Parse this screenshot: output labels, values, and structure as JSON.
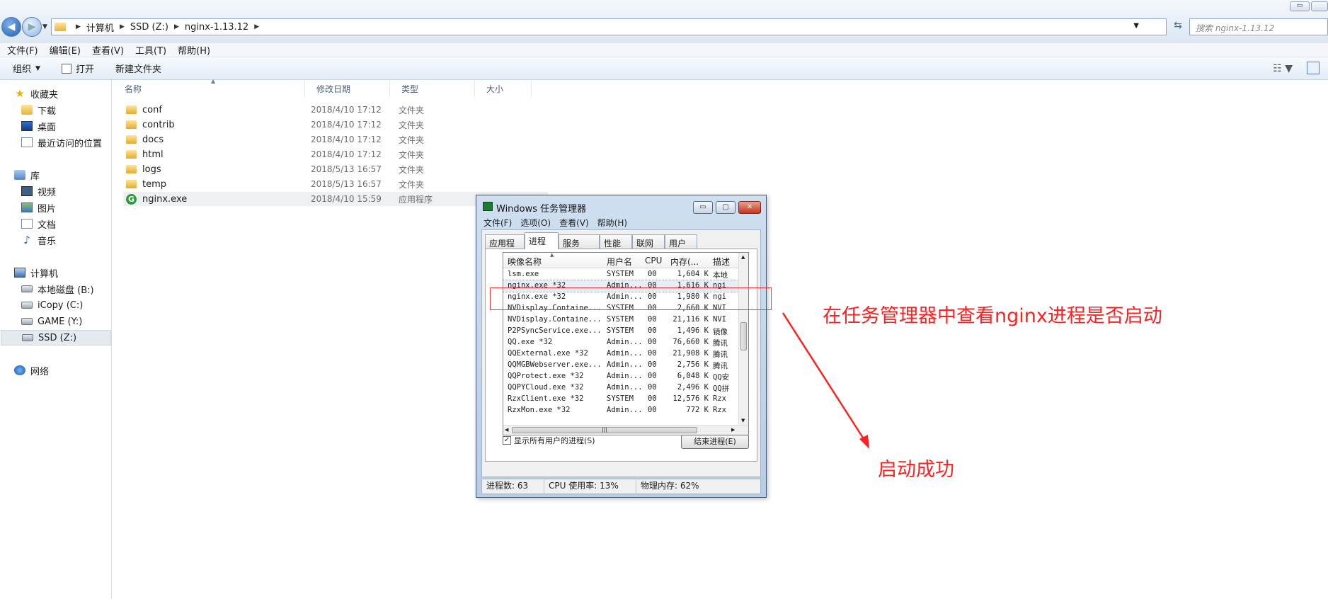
{
  "explorer": {
    "breadcrumb": [
      "计算机",
      "SSD (Z:)",
      "nginx-1.13.12"
    ],
    "search_placeholder": "搜索 nginx-1.13.12",
    "menu": [
      "文件(F)",
      "编辑(E)",
      "查看(V)",
      "工具(T)",
      "帮助(H)"
    ],
    "toolbar": {
      "organize": "组织",
      "open": "打开",
      "new_folder": "新建文件夹"
    },
    "nav": {
      "favorites": "收藏夹",
      "downloads": "下载",
      "desktop": "桌面",
      "recent": "最近访问的位置",
      "libraries": "库",
      "videos": "视频",
      "pictures": "图片",
      "documents": "文档",
      "music": "音乐",
      "computer": "计算机",
      "drive_b": "本地磁盘 (B:)",
      "drive_c": "iCopy (C:)",
      "drive_y": "GAME (Y:)",
      "drive_z": "SSD (Z:)",
      "network": "网络"
    },
    "columns": {
      "name": "名称",
      "date": "修改日期",
      "type": "类型",
      "size": "大小"
    },
    "files": [
      {
        "name": "conf",
        "date": "2018/4/10 17:12",
        "type": "文件夹"
      },
      {
        "name": "contrib",
        "date": "2018/4/10 17:12",
        "type": "文件夹"
      },
      {
        "name": "docs",
        "date": "2018/4/10 17:12",
        "type": "文件夹"
      },
      {
        "name": "html",
        "date": "2018/4/10 17:12",
        "type": "文件夹"
      },
      {
        "name": "logs",
        "date": "2018/5/13 16:57",
        "type": "文件夹"
      },
      {
        "name": "temp",
        "date": "2018/5/13 16:57",
        "type": "文件夹"
      },
      {
        "name": "nginx.exe",
        "date": "2018/4/10 15:59",
        "type": "应用程序"
      }
    ]
  },
  "taskmgr": {
    "title": "Windows 任务管理器",
    "menu": [
      "文件(F)",
      "选项(O)",
      "查看(V)",
      "帮助(H)"
    ],
    "tabs": [
      "应用程序",
      "进程",
      "服务",
      "性能",
      "联网",
      "用户"
    ],
    "columns": {
      "image": "映像名称",
      "user": "用户名",
      "cpu": "CPU",
      "mem": "内存(...",
      "desc": "描述"
    },
    "processes": [
      {
        "image": "lsm.exe",
        "user": "SYSTEM",
        "cpu": "00",
        "mem": "1,604 K",
        "desc": "本地"
      },
      {
        "image": "nginx.exe *32",
        "user": "Admin...",
        "cpu": "00",
        "mem": "1,616 K",
        "desc": "ngi"
      },
      {
        "image": "nginx.exe *32",
        "user": "Admin...",
        "cpu": "00",
        "mem": "1,980 K",
        "desc": "ngi"
      },
      {
        "image": "NVDisplay.Containe...",
        "user": "SYSTEM",
        "cpu": "00",
        "mem": "2,660 K",
        "desc": "NVI"
      },
      {
        "image": "NVDisplay.Containe...",
        "user": "SYSTEM",
        "cpu": "00",
        "mem": "21,116 K",
        "desc": "NVI"
      },
      {
        "image": "P2PSyncService.exe...",
        "user": "SYSTEM",
        "cpu": "00",
        "mem": "1,496 K",
        "desc": "镜像"
      },
      {
        "image": "QQ.exe *32",
        "user": "Admin...",
        "cpu": "00",
        "mem": "76,660 K",
        "desc": "腾讯"
      },
      {
        "image": "QQExternal.exe *32",
        "user": "Admin...",
        "cpu": "00",
        "mem": "21,908 K",
        "desc": "腾讯"
      },
      {
        "image": "QQMGBWebserver.exe...",
        "user": "Admin...",
        "cpu": "00",
        "mem": "2,756 K",
        "desc": "腾讯"
      },
      {
        "image": "QQProtect.exe *32",
        "user": "Admin...",
        "cpu": "00",
        "mem": "6,048 K",
        "desc": "QQ安"
      },
      {
        "image": "QQPYCloud.exe *32",
        "user": "Admin...",
        "cpu": "00",
        "mem": "2,496 K",
        "desc": "QQ拼"
      },
      {
        "image": "RzxClient.exe *32",
        "user": "SYSTEM",
        "cpu": "00",
        "mem": "12,576 K",
        "desc": "Rzx"
      },
      {
        "image": "RzxMon.exe *32",
        "user": "Admin...",
        "cpu": "00",
        "mem": "772 K",
        "desc": "Rzx"
      }
    ],
    "show_all_label": "显示所有用户的进程(S)",
    "show_all_checked": "✓",
    "end_process": "结束进程(E)",
    "status": {
      "count": "进程数: 63",
      "cpu": "CPU 使用率: 13%",
      "mem": "物理内存: 62%"
    }
  },
  "annotations": {
    "main": "在任务管理器中查看nginx进程是否启动",
    "result": "启动成功",
    "color": "#ff2020"
  }
}
